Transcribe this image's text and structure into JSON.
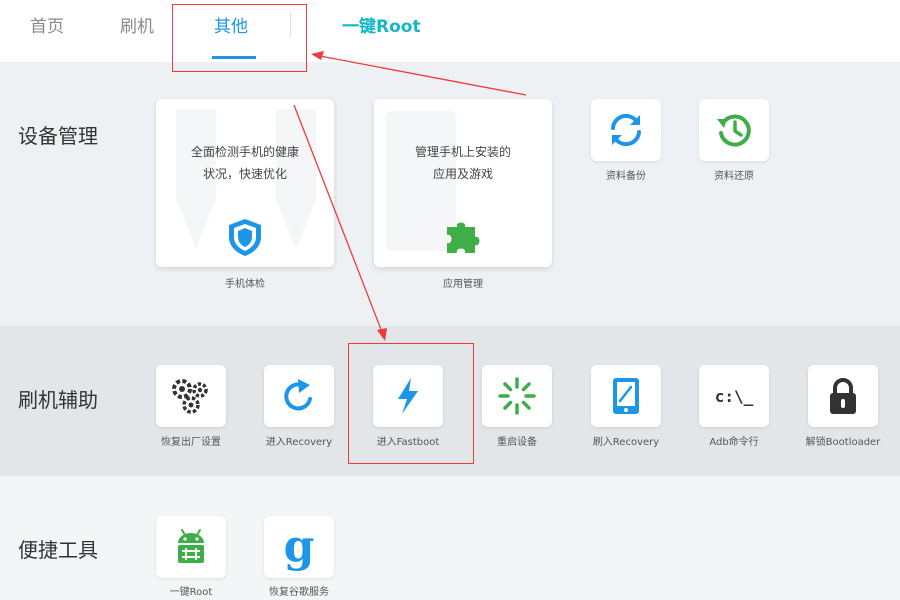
{
  "nav": {
    "tabs": [
      {
        "label": "首页"
      },
      {
        "label": "刷机"
      },
      {
        "label": "其他"
      },
      {
        "label": "一键Root"
      }
    ]
  },
  "device_mgmt": {
    "title": "设备管理",
    "checkup": {
      "desc_line1": "全面检测手机的健康",
      "desc_line2": "状况，快速优化",
      "label": "手机体检"
    },
    "apps": {
      "desc_line1": "管理手机上安装的",
      "desc_line2": "应用及游戏",
      "label": "应用管理"
    },
    "backup_label": "资料备份",
    "restore_label": "资料还原"
  },
  "flash_assist": {
    "title": "刷机辅助",
    "items": [
      {
        "label": "恢复出厂设置",
        "icon": "gears-icon"
      },
      {
        "label": "进入Recovery",
        "icon": "refresh-icon"
      },
      {
        "label": "进入Fastboot",
        "icon": "lightning-icon"
      },
      {
        "label": "重启设备",
        "icon": "spinner-icon"
      },
      {
        "label": "刷入Recovery",
        "icon": "tablet-icon"
      },
      {
        "label": "Adb命令行",
        "icon": "terminal-icon",
        "glyph": "c:\\_"
      },
      {
        "label": "解锁Bootloader",
        "icon": "lock-icon"
      }
    ]
  },
  "tools": {
    "title": "便捷工具",
    "items": [
      {
        "label": "一键Root",
        "icon": "android-icon"
      },
      {
        "label": "恢复谷歌服务",
        "icon": "google-icon",
        "glyph": "g"
      }
    ]
  },
  "colors": {
    "blue": "#1e96e8",
    "green": "#3fae49",
    "teal": "#16b8c8",
    "highlight_red": "#ee3b3b",
    "dark_icon": "#333333"
  }
}
